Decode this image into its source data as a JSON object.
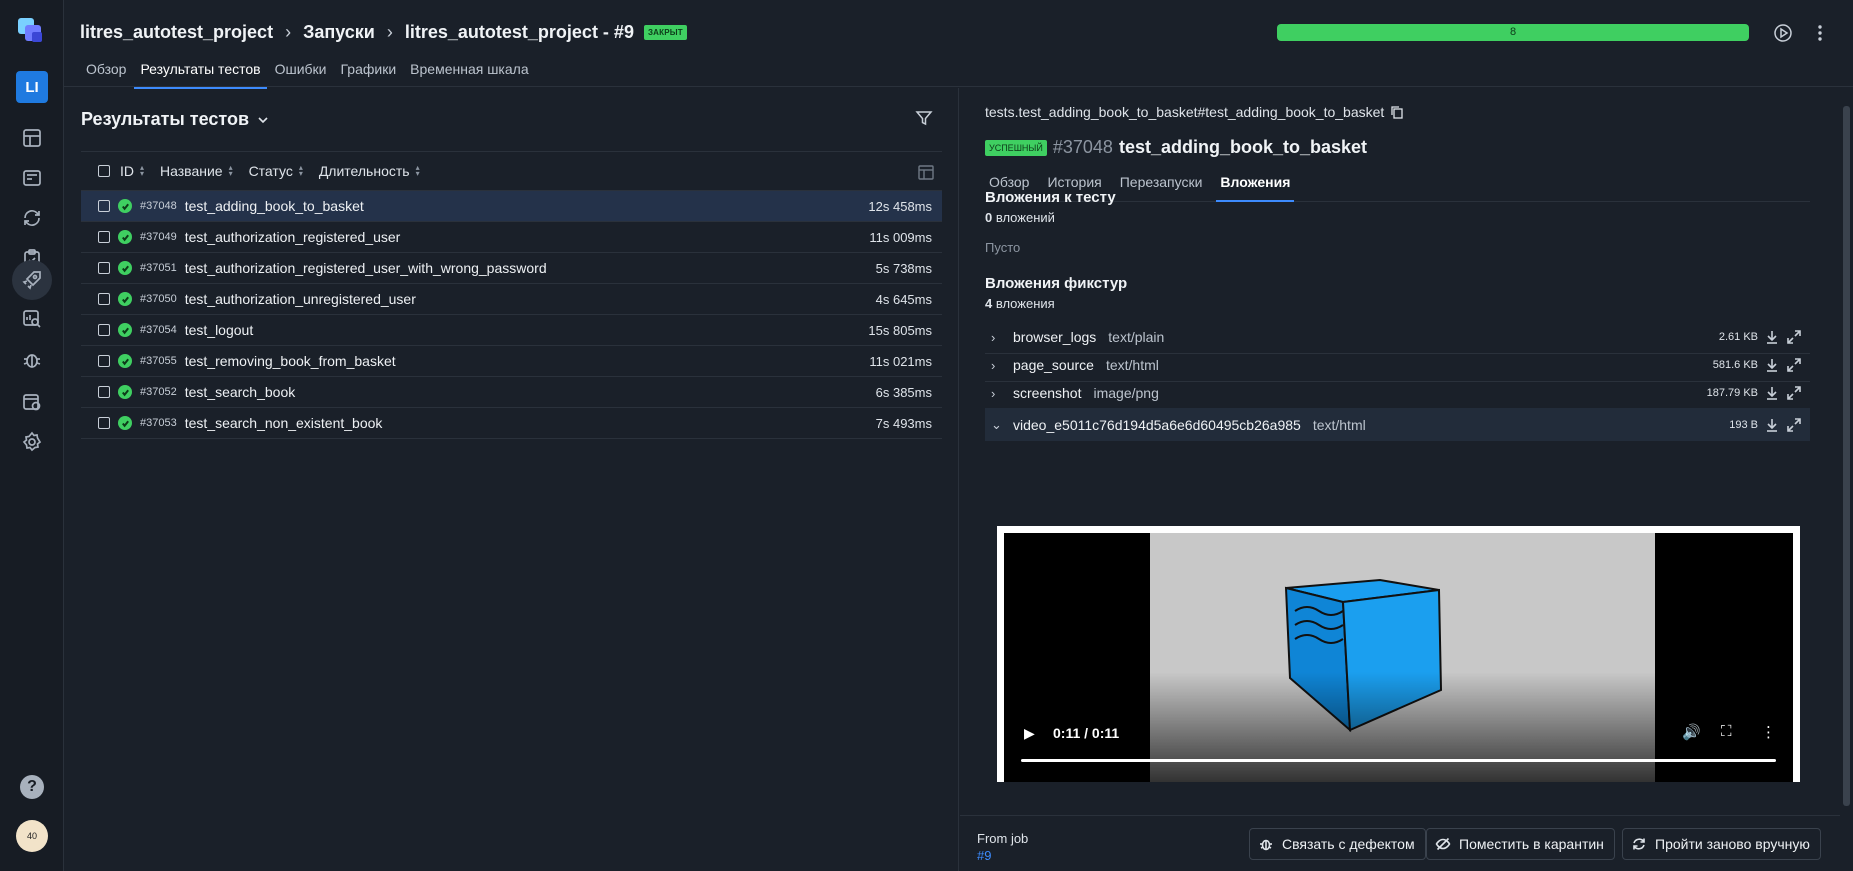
{
  "rail": {
    "project_initials": "LI",
    "items": [
      {
        "name": "dashboard-icon"
      },
      {
        "name": "test-cases-icon"
      },
      {
        "name": "sync-icon"
      },
      {
        "name": "clipboard-icon"
      },
      {
        "name": "launches-rocket-icon"
      },
      {
        "name": "analytics-icon"
      },
      {
        "name": "defects-bug-icon"
      },
      {
        "name": "jobs-icon"
      },
      {
        "name": "settings-icon"
      }
    ],
    "help": "?",
    "avatar_text": "40"
  },
  "header": {
    "breadcrumb": [
      "litres_autotest_project",
      "Запуски",
      "litres_autotest_project - #9"
    ],
    "closed_badge": "ЗАКРЫТ",
    "tabs": [
      "Обзор",
      "Результаты тестов",
      "Ошибки",
      "Графики",
      "Временная шкала"
    ],
    "active_tab": 1,
    "progress_label": "8",
    "progress_fraction": 1.0,
    "accent": "#3d8bfd",
    "success_color": "#3fcf61"
  },
  "left": {
    "title": "Результаты тестов",
    "columns": [
      "ID",
      "Название",
      "Статус",
      "Длительность"
    ],
    "rows": [
      {
        "id": "#37048",
        "name": "test_adding_book_to_basket",
        "duration": "12s 458ms",
        "selected": true
      },
      {
        "id": "#37049",
        "name": "test_authorization_registered_user",
        "duration": "11s 009ms"
      },
      {
        "id": "#37051",
        "name": "test_authorization_registered_user_with_wrong_password",
        "duration": "5s 738ms"
      },
      {
        "id": "#37050",
        "name": "test_authorization_unregistered_user",
        "duration": "4s 645ms"
      },
      {
        "id": "#37054",
        "name": "test_logout",
        "duration": "15s 805ms"
      },
      {
        "id": "#37055",
        "name": "test_removing_book_from_basket",
        "duration": "11s 021ms"
      },
      {
        "id": "#37052",
        "name": "test_search_book",
        "duration": "6s 385ms"
      },
      {
        "id": "#37053",
        "name": "test_search_non_existent_book",
        "duration": "7s 493ms"
      }
    ]
  },
  "right": {
    "path": "tests.test_adding_book_to_basket#test_adding_book_to_basket",
    "status_badge": "УСПЕШНЫЙ",
    "test_id": "#37048",
    "test_name": "test_adding_book_to_basket",
    "tabs": [
      "Обзор",
      "История",
      "Перезапуски",
      "Вложения"
    ],
    "active_tab": 3,
    "test_attachments": {
      "title": "Вложения к тесту",
      "count": "0",
      "count_label": " вложений",
      "empty": "Пусто"
    },
    "fixture_attachments": {
      "title": "Вложения фикстур",
      "count": "4",
      "count_label": " вложения"
    },
    "attachments": [
      {
        "name": "browser_logs",
        "type": "text/plain",
        "size": "2.61 KB",
        "open": false
      },
      {
        "name": "page_source",
        "type": "text/html",
        "size": "581.6 KB",
        "open": false
      },
      {
        "name": "screenshot",
        "type": "image/png",
        "size": "187.79 KB",
        "open": false
      },
      {
        "name": "video_e5011c76d194d5a6e6d60495cb26a985",
        "type": "text/html",
        "size": "193 B",
        "open": true
      }
    ],
    "video": {
      "time": "0:11 / 0:11",
      "progress_fraction": 1.0
    },
    "footer": {
      "from_job": "From job",
      "job_link": "#9",
      "link_defect": "Связать с дефектом",
      "quarantine": "Поместить в карантин",
      "rerun": "Пройти заново вручную"
    }
  }
}
